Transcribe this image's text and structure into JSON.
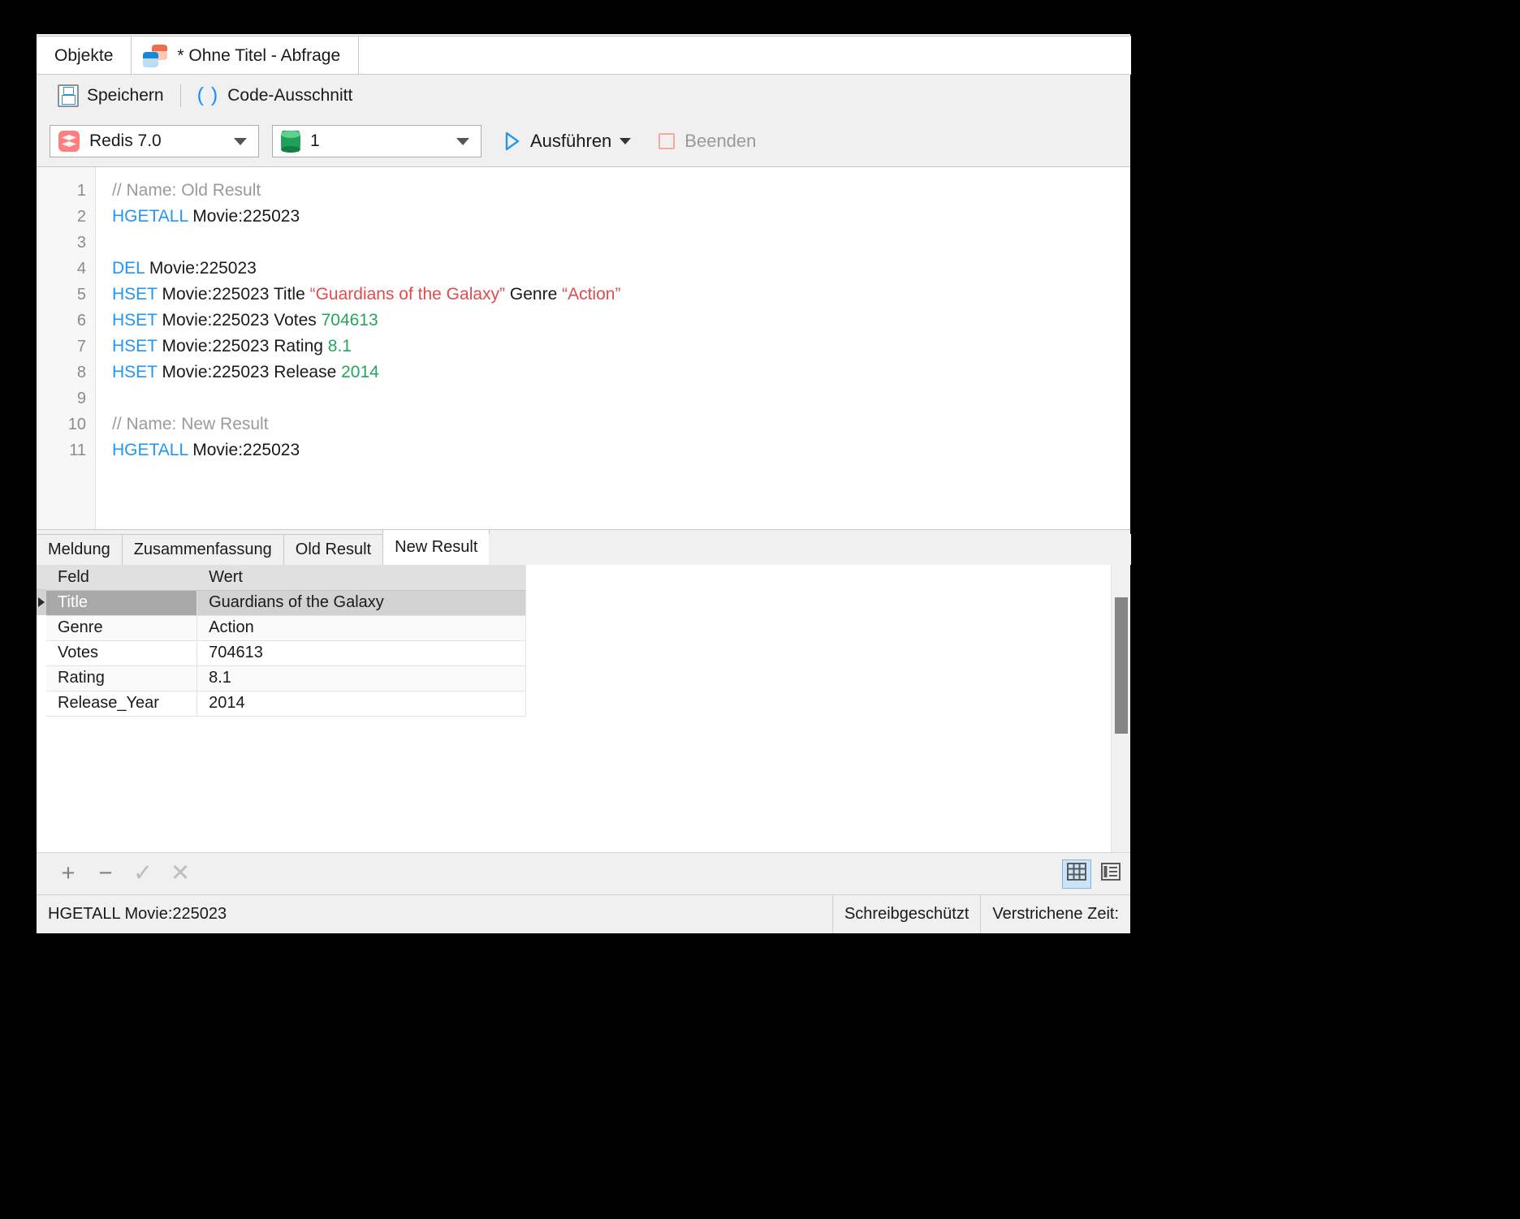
{
  "window": {
    "tabs": [
      {
        "label": "Objekte",
        "icon": null,
        "active": false
      },
      {
        "label": "* Ohne Titel - Abfrage",
        "icon": "query-tab-icon",
        "active": true
      }
    ]
  },
  "toolbar": {
    "save_label": "Speichern",
    "save_icon": "floppy-disk-icon",
    "snippet_label": "Code-Ausschnitt",
    "snippet_icon": "parentheses-icon"
  },
  "toolbar2": {
    "connection": {
      "value": "Redis 7.0",
      "icon": "redis-logo-icon"
    },
    "database": {
      "value": "1",
      "icon": "database-cylinder-icon"
    },
    "run_label": "Ausführen",
    "run_icon": "play-triangle-icon",
    "run_caret_icon": "chevron-down-icon",
    "stop_label": "Beenden",
    "stop_icon": "stop-square-icon"
  },
  "editor": {
    "line_numbers": [
      "1",
      "2",
      "3",
      "4",
      "5",
      "6",
      "7",
      "8",
      "9",
      "10",
      "11"
    ],
    "lines": [
      {
        "n": 1,
        "tokens": [
          {
            "t": "// Name: Old Result",
            "c": "cm"
          }
        ]
      },
      {
        "n": 2,
        "tokens": [
          {
            "t": "HGETALL",
            "c": "kw"
          },
          {
            "t": " Movie:225023",
            "c": ""
          }
        ]
      },
      {
        "n": 3,
        "tokens": []
      },
      {
        "n": 4,
        "tokens": [
          {
            "t": "DEL",
            "c": "kw"
          },
          {
            "t": " Movie:225023",
            "c": ""
          }
        ]
      },
      {
        "n": 5,
        "tokens": [
          {
            "t": "HSET",
            "c": "kw"
          },
          {
            "t": " Movie:225023 Title ",
            "c": ""
          },
          {
            "t": "“Guardians of the Galaxy”",
            "c": "str"
          },
          {
            "t": " Genre ",
            "c": ""
          },
          {
            "t": "“Action”",
            "c": "str"
          }
        ]
      },
      {
        "n": 6,
        "tokens": [
          {
            "t": "HSET",
            "c": "kw"
          },
          {
            "t": " Movie:225023 Votes ",
            "c": ""
          },
          {
            "t": "704613",
            "c": "num"
          }
        ]
      },
      {
        "n": 7,
        "tokens": [
          {
            "t": "HSET",
            "c": "kw"
          },
          {
            "t": " Movie:225023 Rating ",
            "c": ""
          },
          {
            "t": "8.1",
            "c": "num"
          }
        ]
      },
      {
        "n": 8,
        "tokens": [
          {
            "t": "HSET",
            "c": "kw"
          },
          {
            "t": " Movie:225023 Release ",
            "c": ""
          },
          {
            "t": "2014",
            "c": "num"
          }
        ]
      },
      {
        "n": 9,
        "tokens": []
      },
      {
        "n": 10,
        "tokens": [
          {
            "t": "// Name: New Result",
            "c": "cm"
          }
        ]
      },
      {
        "n": 11,
        "tokens": [
          {
            "t": "HGETALL",
            "c": "kw"
          },
          {
            "t": " Movie:225023",
            "c": ""
          }
        ]
      }
    ]
  },
  "result_tabs": [
    {
      "label": "Meldung",
      "active": false
    },
    {
      "label": "Zusammenfassung",
      "active": false
    },
    {
      "label": "Old Result",
      "active": false
    },
    {
      "label": "New Result",
      "active": true
    }
  ],
  "result_grid": {
    "columns": [
      "Feld",
      "Wert"
    ],
    "rows": [
      {
        "field": "Title",
        "value": "Guardians of the Galaxy",
        "selected": true
      },
      {
        "field": "Genre",
        "value": "Action",
        "selected": false
      },
      {
        "field": "Votes",
        "value": "704613",
        "selected": false
      },
      {
        "field": "Rating",
        "value": "8.1",
        "selected": false
      },
      {
        "field": "Release_Year",
        "value": "2014",
        "selected": false
      }
    ]
  },
  "grid_toolbar": {
    "add_icon": "plus-icon",
    "remove_icon": "minus-icon",
    "commit_icon": "check-icon",
    "cancel_icon": "cross-icon",
    "grid_view_icon": "grid-view-icon",
    "form_view_icon": "form-view-icon"
  },
  "statusbar": {
    "query": "HGETALL Movie:225023",
    "readonly": "Schreibgeschützt",
    "elapsed": "Verstrichene Zeit:"
  },
  "colors": {
    "keyword": "#2196f3",
    "string": "#e04b4b",
    "number": "#26a65b",
    "comment": "#9a9a9a",
    "redis_accent": "#ff7f7f",
    "db_accent": "#21a05a",
    "selection": "#a8a8a8",
    "active_toggle": "#cce4f7"
  }
}
